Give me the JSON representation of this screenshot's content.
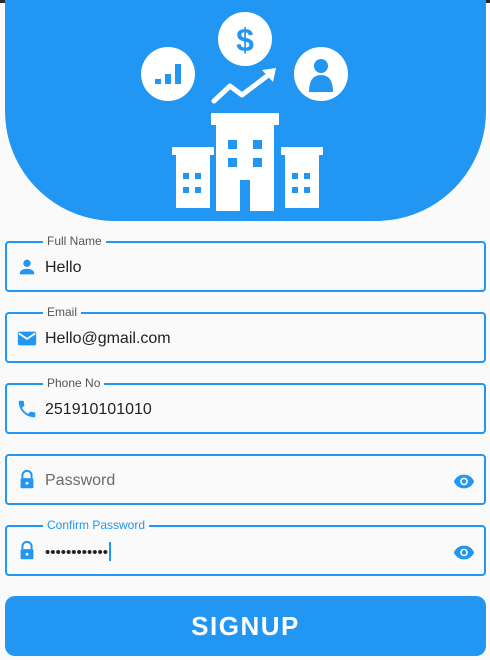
{
  "header": {
    "illustration": [
      "dollar-coin-icon",
      "bar-chart-icon",
      "trend-up-arrow-icon",
      "user-icon",
      "office-buildings-icon"
    ],
    "background_color": "#2196f3"
  },
  "form": {
    "full_name": {
      "label": "Full Name",
      "value": "Hello",
      "icon": "person-icon"
    },
    "email": {
      "label": "Email",
      "value": "Hello@gmail.com",
      "icon": "mail-icon"
    },
    "phone": {
      "label": "Phone No",
      "value": "251910101010",
      "icon": "phone-icon"
    },
    "password": {
      "placeholder": "Password",
      "icon": "lock-icon",
      "toggle_icon": "eye-icon"
    },
    "confirm_password": {
      "label": "Confirm Password",
      "value": "••••••••••••",
      "icon": "lock-icon",
      "toggle_icon": "eye-icon"
    }
  },
  "signup_button": {
    "label": "SIGNUP"
  },
  "colors": {
    "accent": "#2196f3",
    "background": "#fafafa"
  }
}
